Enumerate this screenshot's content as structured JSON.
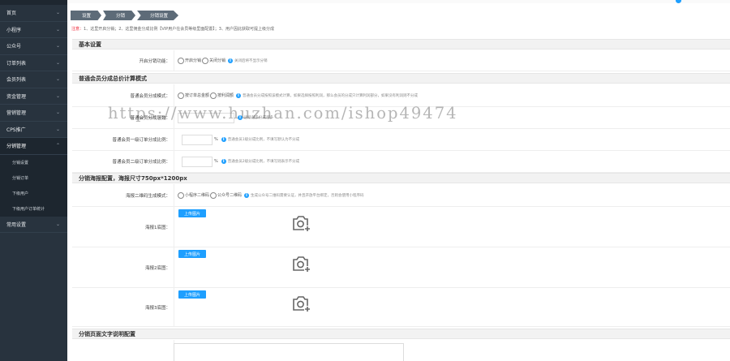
{
  "sidebar": {
    "items": [
      {
        "label": "首页"
      },
      {
        "label": "小程序"
      },
      {
        "label": "公众号"
      },
      {
        "label": "订单列表"
      },
      {
        "label": "会员列表"
      },
      {
        "label": "资金管理"
      },
      {
        "label": "营销管理"
      },
      {
        "label": "CPS推广"
      },
      {
        "label": "分销管理"
      }
    ],
    "sub_items": [
      {
        "label": "分销设置"
      },
      {
        "label": "分销订单"
      },
      {
        "label": "下级用户"
      },
      {
        "label": "下级用户订单统计"
      }
    ],
    "last_item": {
      "label": "常用设置"
    }
  },
  "breadcrumb": [
    "设置",
    "分销",
    "分销设置"
  ],
  "notice": {
    "lead": "注意：",
    "text": "1、这里开启分销；2、这里佣金分成比例【VIP用户在会员等级里面配置】；3、用户因此获取可提上级分成"
  },
  "sections": {
    "basic": "基本设置",
    "normal": "普通会员分成总价计算模式",
    "poster": "分销海报配置，海报尺寸750px*1200px",
    "page_text": "分销页面文字说明配置"
  },
  "fields": {
    "enable": {
      "label": "开启分销功能：",
      "opt1": "开启分销",
      "opt2": "关闭分销",
      "hint": "关闭后将不显示分销"
    },
    "mode": {
      "label": "普通会员分成模式：",
      "opt1": "按订单总金额",
      "opt2": "按利润额",
      "hint": "普通会员分成按照该模式计算，如果选择按照利润，那么会员的分成只计算利润部分，如果没有利润则不分成"
    },
    "level": {
      "label": "普通会员分成层数：",
      "hint": "层级越多分成越多"
    },
    "first": {
      "label": "普通会员一级订单分成比例：",
      "unit": "%",
      "hint": "普通会员1级分成比例，不填写默认为不分成"
    },
    "second": {
      "label": "普通会员二级订单分成比例：",
      "unit": "%",
      "hint": "普通会员2级分成比例，不填写则表示不分成"
    },
    "qr": {
      "label": "海报二维码生成模式：",
      "opt1": "小程序二维码",
      "opt2": "公众号二维码",
      "hint": "生成公众号二维码需要认证，并且开放平台绑定，否则会使用小程序码"
    },
    "poster1": {
      "label": "海报1底图：",
      "button": "上传图片"
    },
    "poster2": {
      "label": "海报2底图：",
      "button": "上传图片"
    },
    "poster3": {
      "label": "海报3底图：",
      "button": "上传图片"
    }
  },
  "watermark": "https://www.huzhan.com/ishop49474",
  "colors": {
    "sidebar": "#28333e",
    "accent": "#1e9fff",
    "notice": "#e23333"
  }
}
